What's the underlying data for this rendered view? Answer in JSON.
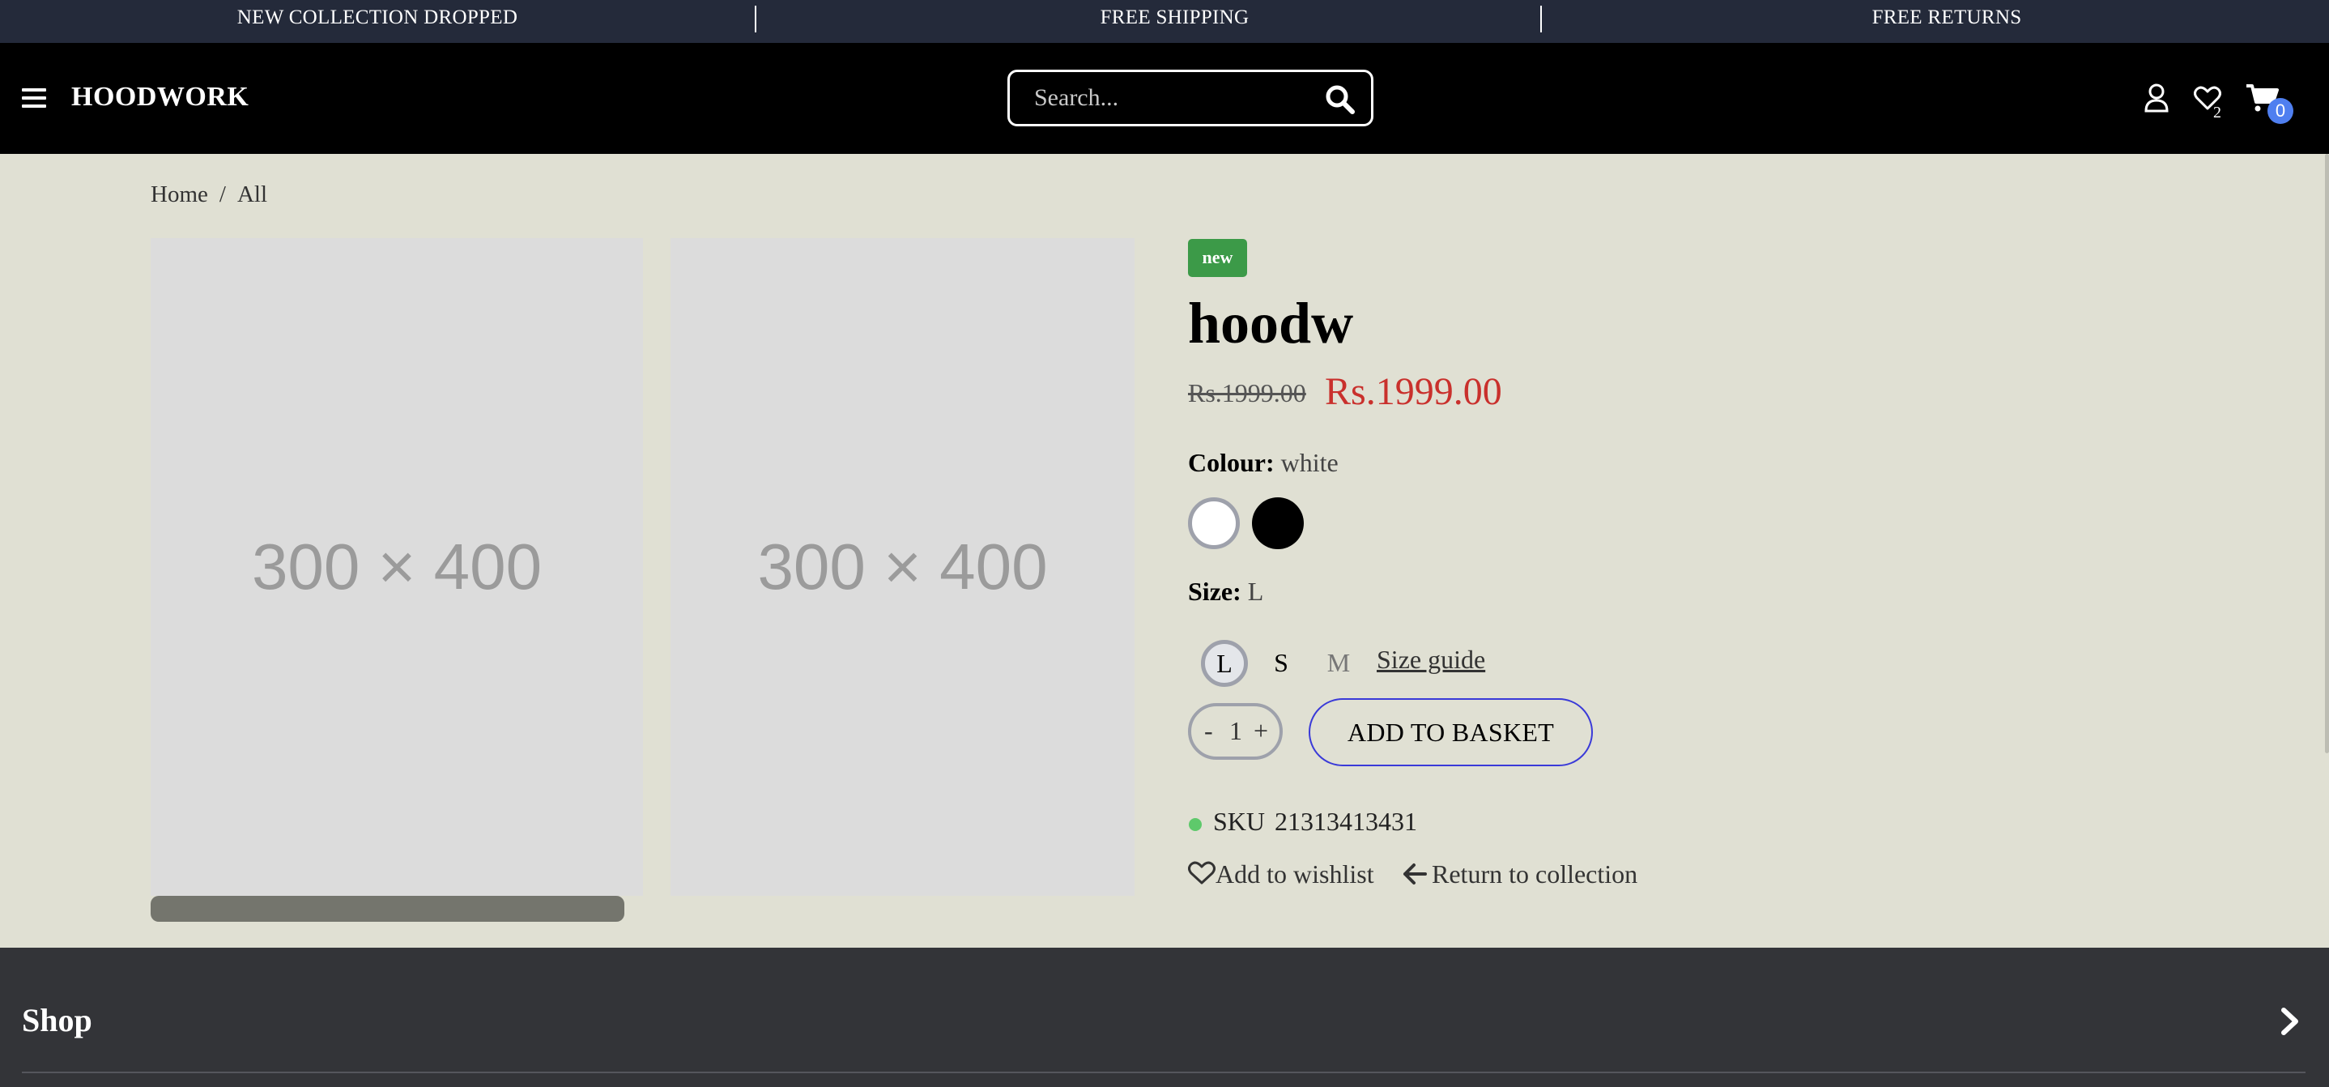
{
  "announcement": {
    "items": [
      "NEW COLLECTION DROPPED",
      "FREE SHIPPING",
      "FREE RETURNS"
    ]
  },
  "header": {
    "logo": "HOODWORK",
    "search_placeholder": "Search...",
    "wishlist_count": "2",
    "cart_count": "0",
    "icons": [
      "menu-icon",
      "search-icon",
      "user-icon",
      "heart-icon",
      "cart-icon"
    ]
  },
  "breadcrumb": {
    "home": "Home",
    "separator": "/",
    "current": "All"
  },
  "gallery": {
    "images": [
      "300 × 400",
      "300 × 400"
    ]
  },
  "product": {
    "badge": "new",
    "title": "hoodw",
    "old_price": "Rs.1999.00",
    "price": "Rs.1999.00",
    "colour_label": "Colour:",
    "colour_value": "white",
    "colours": [
      "#ffffff",
      "#000000"
    ],
    "size_label": "Size:",
    "size_value": "L",
    "sizes": [
      "L",
      "S",
      "M"
    ],
    "size_guide": "Size guide",
    "qty_minus": "-",
    "qty_value": "1",
    "qty_plus": "+",
    "add_to_basket": "ADD TO BASKET",
    "sku_label": "SKU",
    "sku_value": "21313413431",
    "add_to_wishlist": "Add to wishlist",
    "return_to_collection": "Return to collection"
  },
  "footer": {
    "shop": "Shop"
  },
  "colors": {
    "announcement_bg": "#242a3a",
    "header_bg": "#000000",
    "page_bg": "#e0e0d3",
    "badge_new": "#3c9a48",
    "price_red": "#c9302c",
    "cart_badge": "#4f7ff0",
    "button_border": "#3a3ad8",
    "footer_bg": "#333438"
  }
}
